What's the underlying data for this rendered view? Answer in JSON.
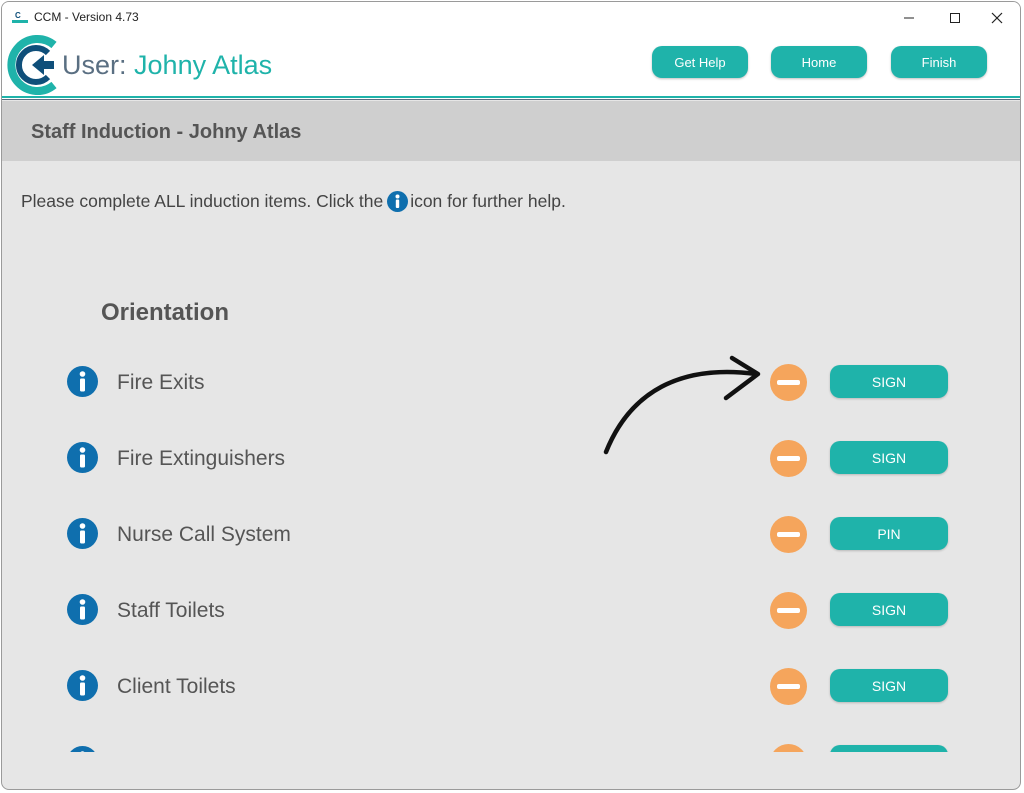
{
  "window": {
    "title": "CCM - Version 4.73"
  },
  "header": {
    "user_prefix": "User:",
    "user_name": "Johny Atlas",
    "buttons": {
      "get_help": "Get Help",
      "home": "Home",
      "finish": "Finish"
    }
  },
  "page": {
    "title": "Staff Induction - Johny Atlas",
    "instruction_before": "Please complete ALL induction items.  Click the",
    "instruction_after": "icon for further help.",
    "group_title": "Orientation"
  },
  "items": [
    {
      "label": "Fire Exits",
      "action": "SIGN"
    },
    {
      "label": "Fire Extinguishers",
      "action": "SIGN"
    },
    {
      "label": "Nurse Call System",
      "action": "PIN"
    },
    {
      "label": "Staff Toilets",
      "action": "SIGN"
    },
    {
      "label": "Client Toilets",
      "action": "SIGN"
    },
    {
      "label": "",
      "action": ""
    }
  ],
  "colors": {
    "accent": "#1fb3aa",
    "info_icon": "#0f6fae",
    "status_pending": "#f5a55c",
    "section_bg": "#cfcfcf"
  }
}
